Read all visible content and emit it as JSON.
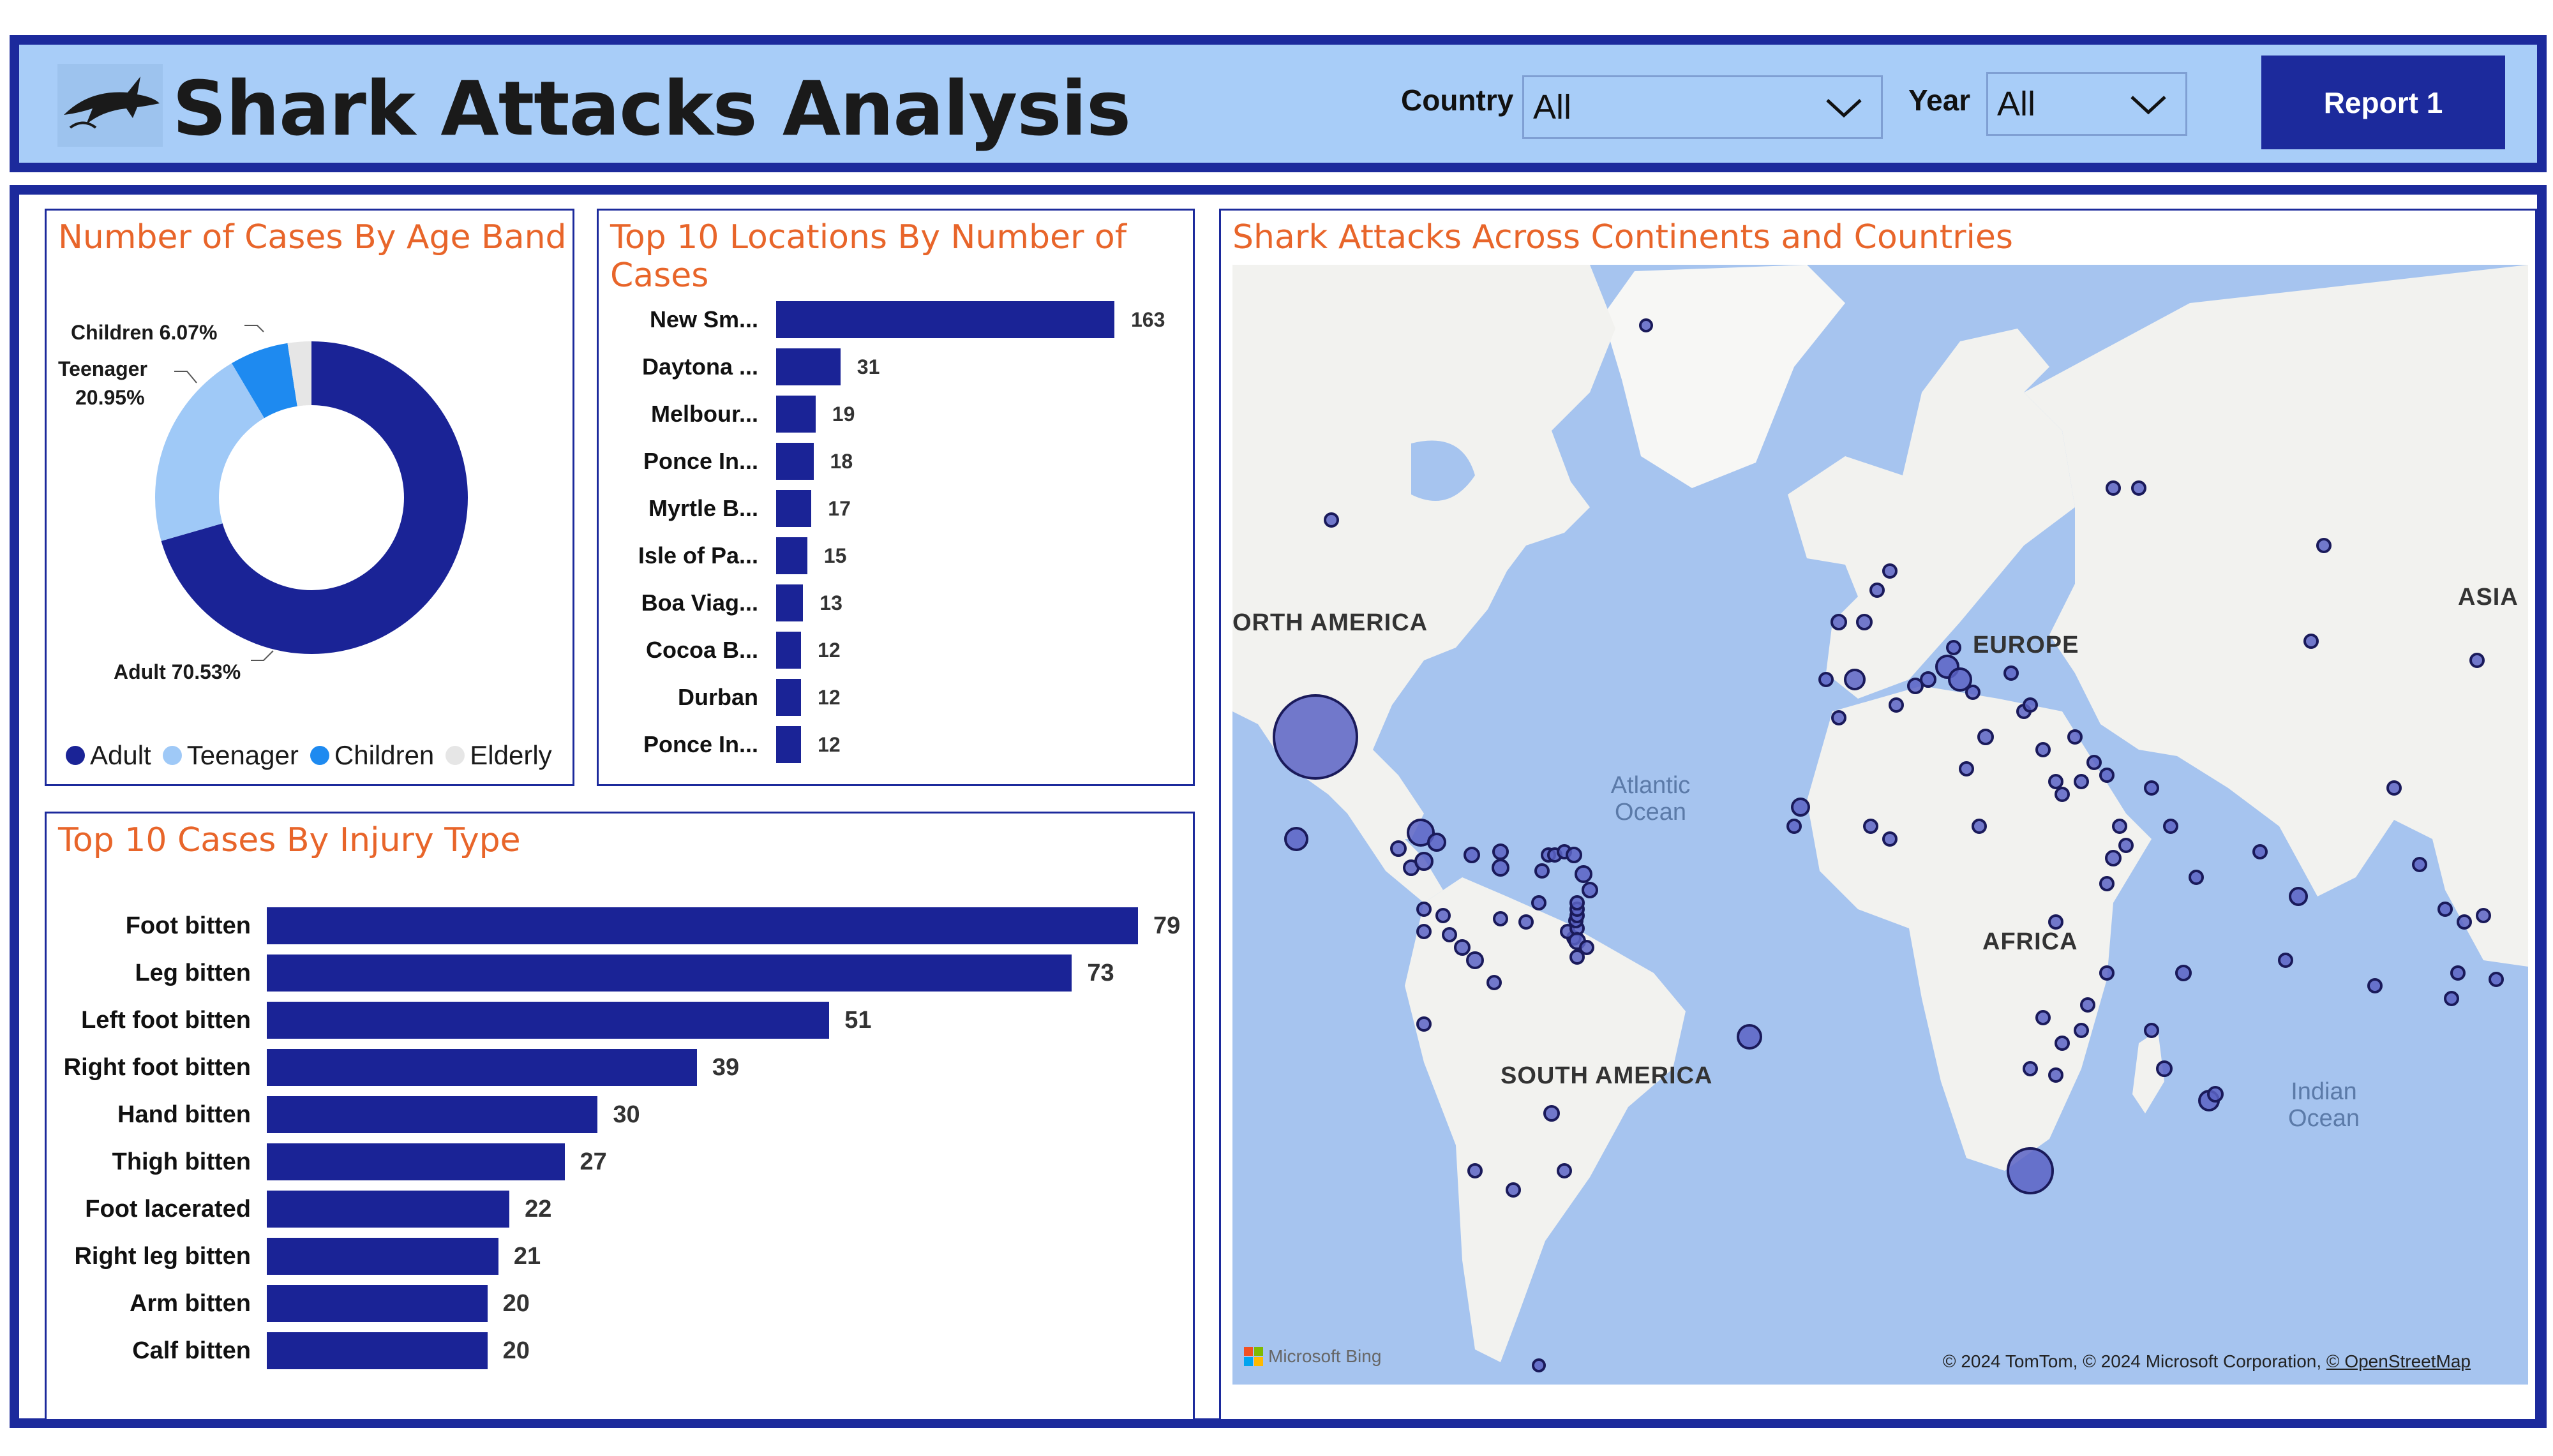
{
  "header": {
    "title": "Shark Attacks Analysis",
    "logo_icon": "shark-logo-icon",
    "country_label": "Country",
    "country_value": "All",
    "year_label": "Year",
    "year_value": "All",
    "report_button": "Report 1"
  },
  "age_band": {
    "title": "Number of Cases By Age Band",
    "labels": {
      "children": "Children 6.07%",
      "teenager_line1": "Teenager",
      "teenager_line2": "20.95%",
      "adult": "Adult 70.53%"
    },
    "legend": [
      "Adult",
      "Teenager",
      "Children",
      "Elderly"
    ],
    "colors": {
      "Adult": "#1a2396",
      "Teenager": "#9fc9f7",
      "Children": "#1e8af0",
      "Elderly": "#e6e6e6"
    },
    "chart_data": {
      "type": "pie",
      "categories": [
        "Adult",
        "Teenager",
        "Children",
        "Elderly"
      ],
      "values": [
        70.53,
        20.95,
        6.07,
        2.45
      ]
    }
  },
  "locations": {
    "title": "Top 10 Locations By Number of Cases",
    "chart_data": {
      "type": "bar",
      "categories": [
        "New Sm...",
        "Daytona ...",
        "Melbour...",
        "Ponce In...",
        "Myrtle B...",
        "Isle of Pa...",
        "Boa Viag...",
        "Cocoa B...",
        "Durban",
        "Ponce In..."
      ],
      "values": [
        163,
        31,
        19,
        18,
        17,
        15,
        13,
        12,
        12,
        12
      ]
    }
  },
  "injury": {
    "title": "Top 10 Cases By Injury Type",
    "chart_data": {
      "type": "bar",
      "categories": [
        "Foot bitten",
        "Leg bitten",
        "Left foot bitten",
        "Right foot bitten",
        "Hand bitten",
        "Thigh bitten",
        "Foot lacerated",
        "Right leg bitten",
        "Arm bitten",
        "Calf bitten"
      ],
      "values": [
        79,
        73,
        51,
        39,
        30,
        27,
        22,
        21,
        20,
        20
      ]
    }
  },
  "map": {
    "title": "Shark Attacks Across Continents and Countries",
    "labels": {
      "north_america": "ORTH AMERICA",
      "europe": "EUROPE",
      "asia": "ASIA",
      "africa": "AFRICA",
      "south_america": "SOUTH AMERICA",
      "atlantic_1": "Atlantic",
      "atlantic_2": "Ocean",
      "indian_1": "Indian",
      "indian_2": "Ocean"
    },
    "bing": "Microsoft Bing",
    "attribution": "© 2024 TomTom, © 2024 Microsoft Corporation, ",
    "attribution_link": "© OpenStreetMap"
  }
}
